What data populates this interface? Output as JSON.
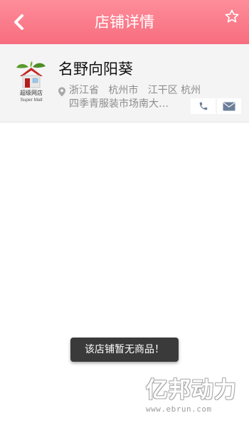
{
  "header": {
    "title": "店铺详情",
    "back_icon": "chevron-left-icon",
    "favorite_icon": "star-outline-icon",
    "background": "#f97d8c"
  },
  "store": {
    "name": "名野向阳葵",
    "address": "浙江省   杭州市   江干区 杭州四季青服装市场南大…",
    "logo": {
      "icon": "house-with-leaves-logo",
      "label_cn": "超级网店",
      "label_en": "Super Mall"
    },
    "location_icon": "location-pin-icon",
    "call_icon": "phone-icon",
    "mail_icon": "envelope-icon"
  },
  "toast": {
    "message": "该店铺暂无商品！"
  },
  "watermark": {
    "brand": "亿邦动力",
    "url": "www.ebrun.com"
  }
}
